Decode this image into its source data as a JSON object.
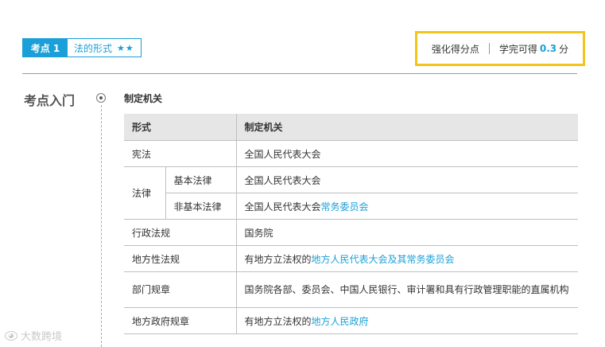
{
  "tag": {
    "label": "考点 1",
    "title": "法的形式",
    "stars": "★★"
  },
  "score": {
    "label": "强化得分点",
    "gain_label": "学完可得",
    "value": "0.3",
    "unit": "分"
  },
  "section": {
    "title": "考点入门",
    "subtitle": "制定机关"
  },
  "table": {
    "headers": [
      "形式",
      "制定机关"
    ],
    "rows": [
      {
        "form": "宪法",
        "organ_pre": "全国人民代表大会",
        "organ_hl": "",
        "organ_post": ""
      },
      {
        "form": "法律",
        "sub": "基本法律",
        "organ_pre": "全国人民代表大会",
        "organ_hl": "",
        "organ_post": ""
      },
      {
        "sub": "非基本法律",
        "organ_pre": "全国人民代表大会",
        "organ_hl": "常务委员会",
        "organ_post": ""
      },
      {
        "form": "行政法规",
        "organ_pre": "国务院",
        "organ_hl": "",
        "organ_post": ""
      },
      {
        "form": "地方性法规",
        "organ_pre": "有地方立法权的",
        "organ_hl": "地方人民代表大会及其常务委员会",
        "organ_post": ""
      },
      {
        "form": "部门规章",
        "organ_pre": "国务院各部、委员会、中国人民银行、审计署和具有行政管理职能的直属机构",
        "organ_hl": "",
        "organ_post": ""
      },
      {
        "form": "地方政府规章",
        "organ_pre": "有地方立法权的",
        "organ_hl": "地方人民政府",
        "organ_post": ""
      }
    ]
  },
  "watermark": {
    "text": "大数跨境",
    "icon": "logo-icon"
  },
  "colors": {
    "accent": "#1a9fd8",
    "highlight_box": "#f3c41a",
    "header_bg": "#e6e6e6"
  }
}
